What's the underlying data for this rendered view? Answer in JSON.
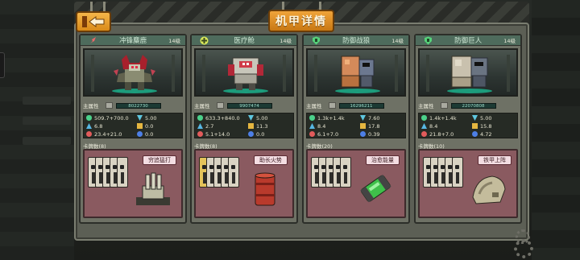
{
  "title": "机甲详情",
  "colors": {
    "accent": "#e49a2e",
    "panel": "#5c5f55",
    "card_head": "#4e6b5c",
    "skill_box": "#8a5a60"
  },
  "labels": {
    "main_attr": "主属性"
  },
  "mechs": [
    {
      "name": "冲锋麋鹿",
      "level": "14级",
      "type_icon": "rocket-icon",
      "main_attr_value": "8022730",
      "stats": {
        "hp": "509.7+700.0",
        "speed": "5.00",
        "armor": "6.8",
        "shield": "0.0",
        "attack": "23.4+21.0",
        "crit": "0.0"
      },
      "cards": "卡牌数(8)",
      "skill": "穷追猛打"
    },
    {
      "name": "医疗舱",
      "level": "14级",
      "type_icon": "heal-cross-icon",
      "main_attr_value": "9907474",
      "stats": {
        "hp": "633.3+840.0",
        "speed": "5.00",
        "armor": "2.7",
        "shield": "11.3",
        "attack": "5.1+14.0",
        "crit": "0.0"
      },
      "cards": "卡牌数(8)",
      "skill": "助长火势"
    },
    {
      "name": "防御战狼",
      "level": "14级",
      "type_icon": "shield-icon",
      "main_attr_value": "16296211",
      "stats": {
        "hp": "1.3k+1.4k",
        "speed": "7.60",
        "armor": "8.4",
        "shield": "17.8",
        "attack": "6.1+7.0",
        "crit": "0.39"
      },
      "cards": "卡牌数(20)",
      "skill": "治愈能量"
    },
    {
      "name": "防御巨人",
      "level": "14级",
      "type_icon": "shield-icon",
      "main_attr_value": "22070808",
      "stats": {
        "hp": "1.4k+1.4k",
        "speed": "5.00",
        "armor": "8.4",
        "shield": "15.8",
        "attack": "21.8+7.0",
        "crit": "4.72"
      },
      "cards": "卡牌数(10)",
      "skill": "铁甲上阵"
    }
  ]
}
